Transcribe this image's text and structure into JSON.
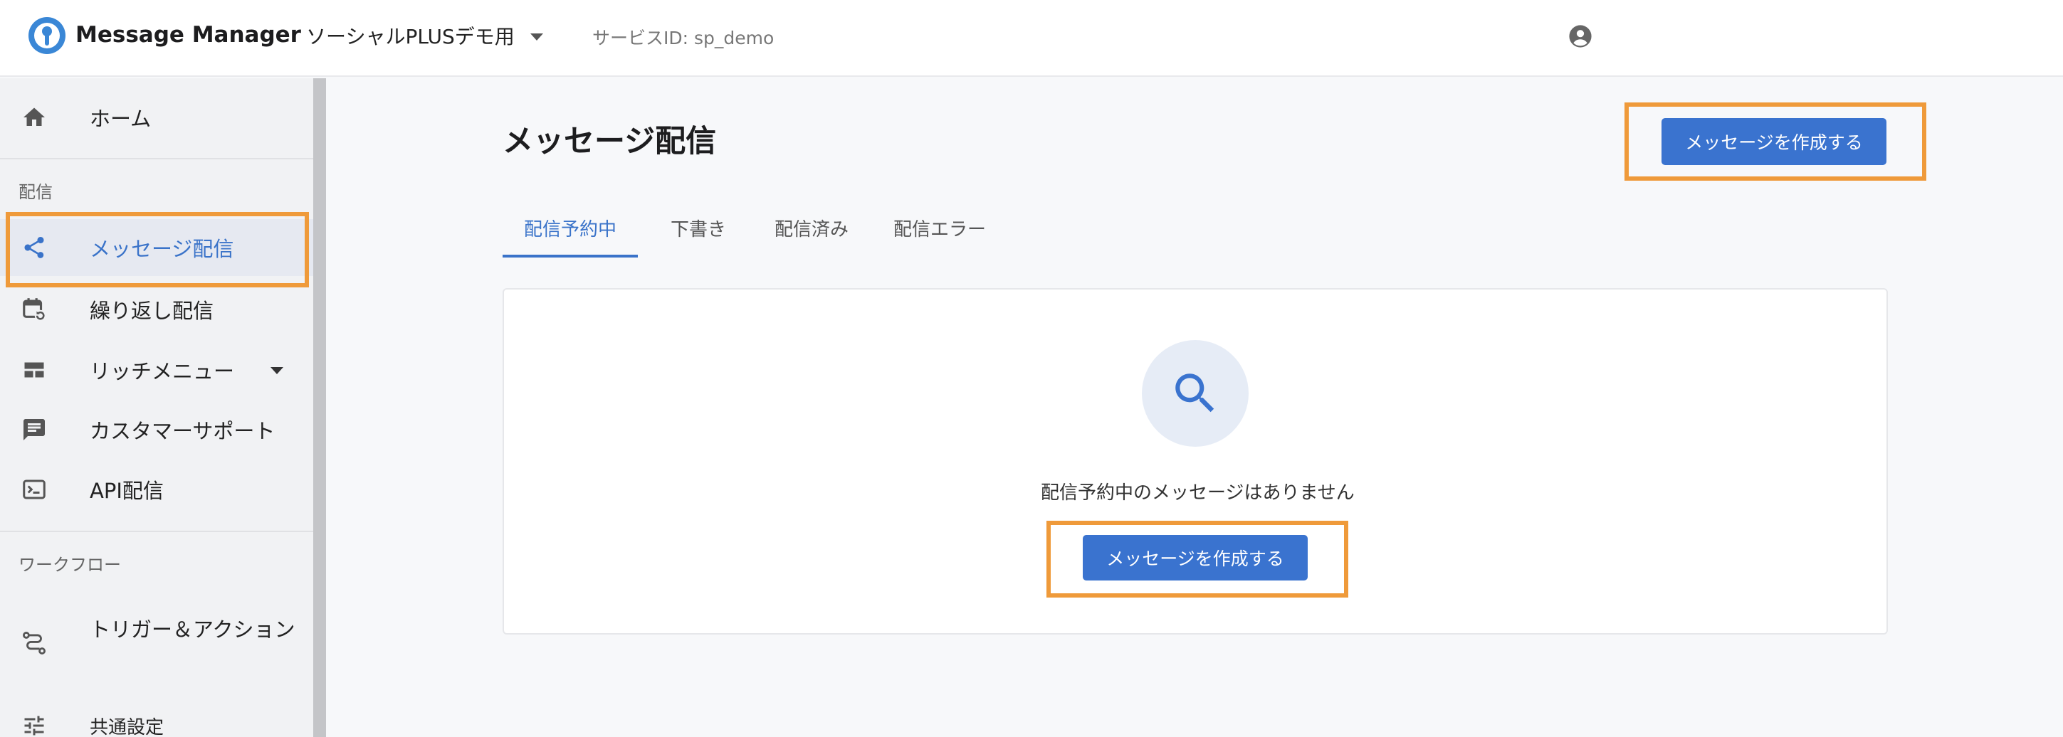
{
  "header": {
    "app_name": "Message Manager",
    "account_name": "ソーシャルPLUSデモ用",
    "service_id": "サービスID: sp_demo"
  },
  "sidebar": {
    "home_label": "ホーム",
    "section_delivery": "配信",
    "items": [
      {
        "label": "メッセージ配信",
        "icon": "share-icon",
        "active": true
      },
      {
        "label": "繰り返し配信",
        "icon": "calendar-repeat-icon"
      },
      {
        "label": "リッチメニュー",
        "icon": "layout-icon",
        "has_dropdown": true
      },
      {
        "label": "カスタマーサポート",
        "icon": "chat-icon"
      },
      {
        "label": "API配信",
        "icon": "terminal-icon"
      }
    ],
    "section_workflow": "ワークフロー",
    "workflow_items": [
      {
        "label": "トリガー＆アクション",
        "icon": "route-icon"
      },
      {
        "label": "共通設定",
        "icon": "sliders-icon"
      }
    ]
  },
  "main": {
    "title": "メッセージ配信",
    "create_button_label": "メッセージを作成する",
    "tabs": [
      {
        "label": "配信予約中",
        "active": true
      },
      {
        "label": "下書き"
      },
      {
        "label": "配信済み"
      },
      {
        "label": "配信エラー"
      }
    ],
    "empty_state": {
      "text": "配信予約中のメッセージはありません",
      "button_label": "メッセージを作成する"
    }
  },
  "colors": {
    "primary": "#3a73cf",
    "highlight": "#ef9a3a",
    "logo": "#3a87d6"
  }
}
